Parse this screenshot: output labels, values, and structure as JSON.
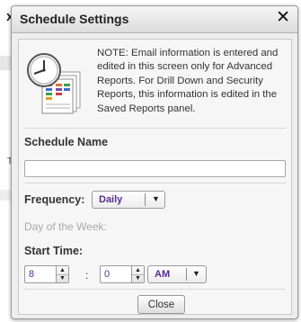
{
  "background": {
    "letter": "x",
    "side_text": "T"
  },
  "dialog": {
    "title": "Schedule Settings",
    "close_glyph": "✕",
    "note": "NOTE: Email information is entered and edited in this screen only for Advanced Reports. For Drill Down and Security Reports, this information is edited in the Saved Reports panel.",
    "schedule_name": {
      "label": "Schedule Name",
      "value": ""
    },
    "frequency": {
      "label": "Frequency:",
      "value": "Daily"
    },
    "day_of_week": {
      "label": "Day of the Week:"
    },
    "start_time": {
      "label": "Start Time:",
      "hour": "8",
      "separator": ":",
      "minute": "0",
      "ampm": "AM"
    },
    "close_button": "Close"
  },
  "icons": {
    "clock": "clock-icon",
    "reports": "report-sheets-icon",
    "dropdown": "chevron-down-icon",
    "spin_up": "arrow-up-icon",
    "spin_down": "arrow-down-icon"
  },
  "colors": {
    "select_text": "#5a2b91",
    "dialog_bg": "#eeeeee"
  }
}
